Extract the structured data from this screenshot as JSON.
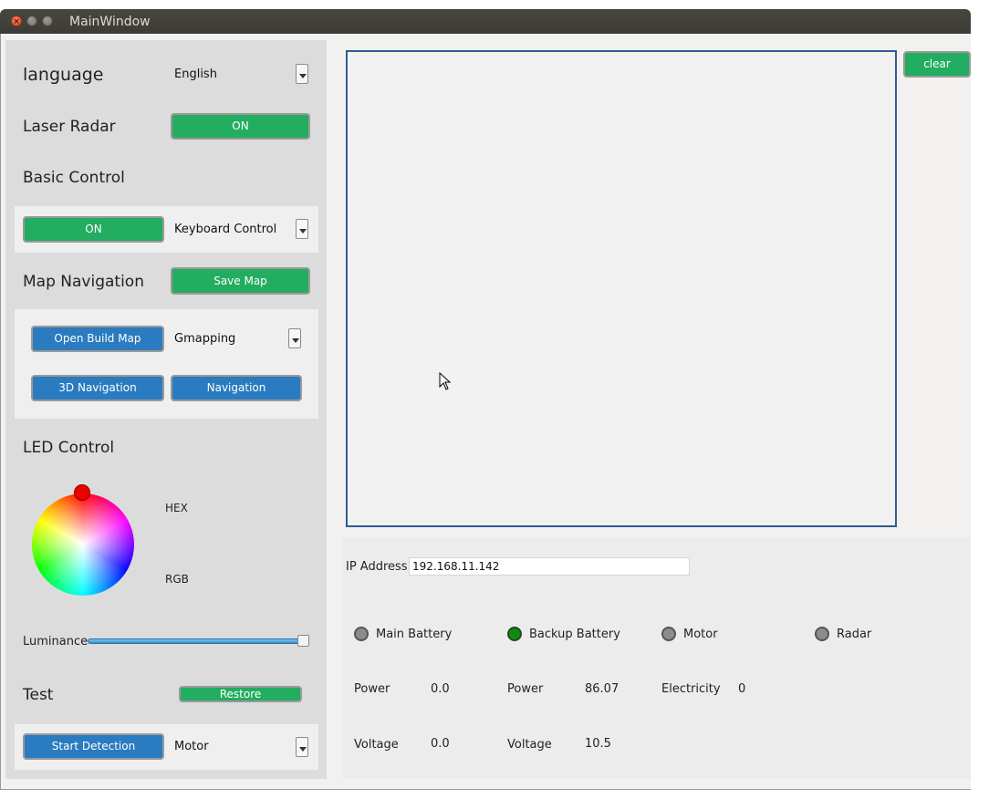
{
  "window": {
    "title": "MainWindow"
  },
  "left": {
    "language": {
      "label": "language",
      "value": "English"
    },
    "laser_radar": {
      "label": "Laser Radar",
      "button": "ON"
    },
    "basic_control": {
      "label": "Basic Control",
      "on_button": "ON",
      "mode": "Keyboard Control"
    },
    "map_navigation": {
      "label": "Map Navigation",
      "save_button": "Save Map",
      "open_build_map": "Open Build Map",
      "algorithm": "Gmapping",
      "nav3d_button": "3D Navigation",
      "nav_button": "Navigation"
    },
    "led_control": {
      "label": "LED Control",
      "hex_label": "HEX",
      "rgb_label": "RGB",
      "knob_color": "#ee0000"
    },
    "luminance": {
      "label": "Luminance",
      "value_fraction": 1.0
    },
    "test": {
      "label": "Test",
      "restore_button": "Restore",
      "start_button": "Start Detection",
      "target": "Motor"
    }
  },
  "right": {
    "clear_button": "clear",
    "ip": {
      "label": "IP Address",
      "value": "192.168.11.142"
    },
    "status": {
      "main_battery": {
        "label": "Main Battery",
        "state": "grey"
      },
      "backup_battery": {
        "label": "Backup Battery",
        "state": "green"
      },
      "motor": {
        "label": "Motor",
        "state": "grey"
      },
      "radar": {
        "label": "Radar",
        "state": "grey"
      }
    },
    "readings": {
      "main_power_label": "Power",
      "main_power": "0.0",
      "main_voltage_label": "Voltage",
      "main_voltage": "0.0",
      "backup_power_label": "Power",
      "backup_power": "86.07",
      "backup_voltage_label": "Voltage",
      "backup_voltage": "10.5",
      "electricity_label": "Electricity",
      "electricity": "0"
    }
  },
  "colors": {
    "accent_green": "#22ad60",
    "accent_blue": "#2a7bbf",
    "view_border": "#2c5c94"
  }
}
